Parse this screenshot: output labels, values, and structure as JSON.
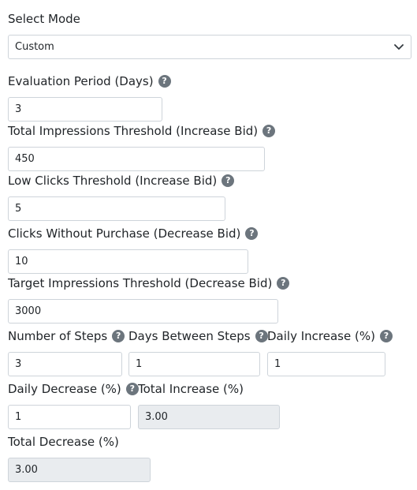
{
  "mode": {
    "label": "Select Mode",
    "selected": "Custom"
  },
  "evaluation_period": {
    "label": "Evaluation Period (Days)",
    "value": "3"
  },
  "total_impressions_increase": {
    "label": "Total Impressions Threshold (Increase Bid)",
    "value": "450"
  },
  "low_clicks_increase": {
    "label": "Low Clicks Threshold (Increase Bid)",
    "value": "5"
  },
  "clicks_without_purchase": {
    "label": "Clicks Without Purchase (Decrease Bid)",
    "value": "10"
  },
  "target_impressions_decrease": {
    "label": "Target Impressions Threshold (Decrease Bid)",
    "value": "3000"
  },
  "number_of_steps": {
    "label": "Number of Steps",
    "value": "3"
  },
  "days_between_steps": {
    "label": "Days Between Steps",
    "value": "1"
  },
  "daily_increase": {
    "label": "Daily Increase (%)",
    "value": "1"
  },
  "daily_decrease": {
    "label": "Daily Decrease (%)",
    "value": "1"
  },
  "total_increase": {
    "label": "Total Increase (%)",
    "value": "3.00"
  },
  "total_decrease": {
    "label": "Total Decrease (%)",
    "value": "3.00"
  },
  "help_glyph": "?",
  "colors": {
    "help_icon_bg": "#6c757d",
    "readonly_bg": "#e9ecef",
    "border": "#ced4da"
  }
}
